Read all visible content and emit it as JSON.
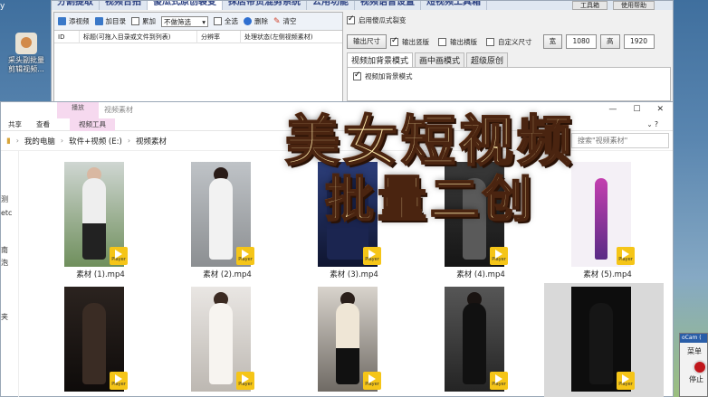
{
  "desktop": {
    "top_label": "y",
    "icon_label_1": "采头副批量",
    "icon_label_2": "剪辑视频..."
  },
  "app": {
    "main_tabs": [
      "分割提取",
      "视频合拍",
      "傻瓜式原创裂变",
      "抹店带货混剪系统",
      "公用功能",
      "视频语音设置",
      "短视频工具箱"
    ],
    "top_buttons": [
      "工具箱",
      "使用帮助"
    ],
    "toolbar": {
      "add_video": "添视频",
      "add_dir": "加目录",
      "append": "累加",
      "filter": "不做筛选",
      "select_all": "全选",
      "delete": "删除",
      "clear": "清空"
    },
    "columns": [
      "ID",
      "标题(可拖入目录或文件到列表)",
      "分辨率",
      "处理状态(左侧视频素材)"
    ],
    "right": {
      "enable_fission": "启用傻瓜式裂变",
      "output_size": "输出尺寸",
      "output_portrait": "输出竖版",
      "output_landscape": "输出横版",
      "custom_size": "自定义尺寸",
      "width_label": "宽",
      "width_value": "1080",
      "height_label": "高",
      "height_value": "1920",
      "sub_tabs": [
        "视频加背景模式",
        "画中画模式",
        "超级原创"
      ],
      "bg_mode": "视频加背景模式"
    }
  },
  "explorer": {
    "context_tab": "播放",
    "title": "视频素材",
    "ribbon": [
      "共享",
      "查看",
      "视频工具"
    ],
    "breadcrumbs": [
      "我的电脑",
      "软件+视频 (E:)",
      "视频素材"
    ],
    "search_placeholder": "搜索\"视频素材\"",
    "nav_items": [
      "测",
      "etc",
      "南",
      "泡",
      "夹"
    ],
    "badge": "Player",
    "files": [
      {
        "name": "素材 (1).mp4"
      },
      {
        "name": "素材 (2).mp4"
      },
      {
        "name": "素材 (3).mp4"
      },
      {
        "name": "素材 (4).mp4"
      },
      {
        "name": "素材 (5).mp4"
      },
      {
        "name": ""
      },
      {
        "name": ""
      },
      {
        "name": ""
      },
      {
        "name": ""
      },
      {
        "name": ""
      }
    ]
  },
  "overlay": {
    "line1": "美女短视频",
    "line2": "批量二创"
  },
  "ocam": {
    "title": "oCam (",
    "menu": "菜单",
    "stop": "停止"
  },
  "colors": {
    "overlay_fill": "#fbe7a8",
    "overlay_stroke": "#4a2410",
    "badge": "#f5c518",
    "context_tab": "#f6d9ef"
  }
}
